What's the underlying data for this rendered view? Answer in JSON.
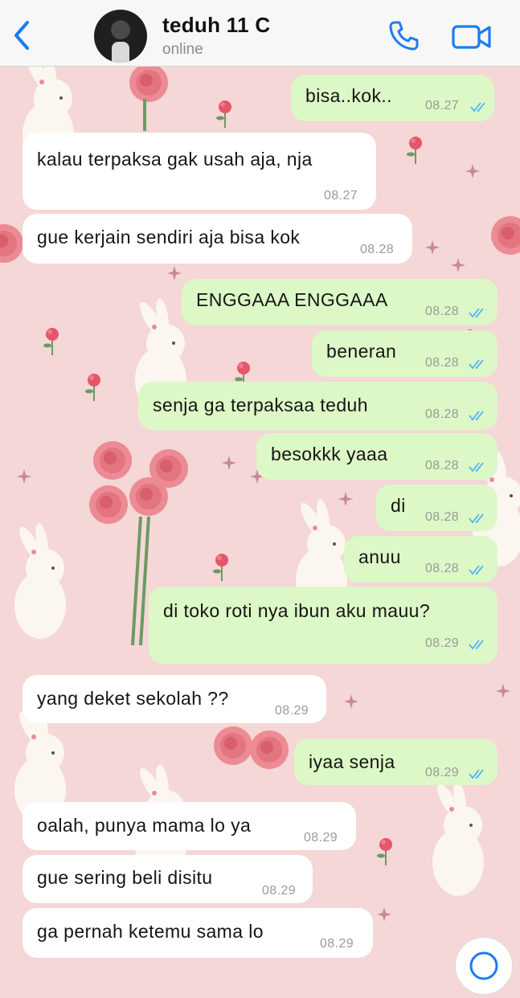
{
  "header": {
    "contact_name": "teduh 11 C",
    "status": "online",
    "accent": "#1b7cf2"
  },
  "messages": [
    {
      "dir": "out",
      "text": "bisa..kok..",
      "time": "08.27",
      "read": true
    },
    {
      "dir": "in",
      "text": "kalau terpaksa gak usah aja, nja",
      "time": "08.27"
    },
    {
      "dir": "in",
      "text": "gue kerjain sendiri aja bisa kok",
      "time": "08.28"
    },
    {
      "dir": "out",
      "text": "ENGGAAA ENGGAAA",
      "time": "08.28",
      "read": true
    },
    {
      "dir": "out",
      "text": "beneran",
      "time": "08.28",
      "read": true
    },
    {
      "dir": "out",
      "text": "senja ga terpaksaa teduh",
      "time": "08.28",
      "read": true
    },
    {
      "dir": "out",
      "text": "besokkk yaaa",
      "time": "08.28",
      "read": true
    },
    {
      "dir": "out",
      "text": "di",
      "time": "08.28",
      "read": true
    },
    {
      "dir": "out",
      "text": "anuu",
      "time": "08.28",
      "read": true
    },
    {
      "dir": "out",
      "text": "di toko roti nya ibun aku mauu?",
      "time": "08.29",
      "read": true
    },
    {
      "dir": "in",
      "text": "yang deket sekolah ??",
      "time": "08.29"
    },
    {
      "dir": "out",
      "text": "iyaa senja",
      "time": "08.29",
      "read": true
    },
    {
      "dir": "in",
      "text": "oalah, punya mama lo ya",
      "time": "08.29"
    },
    {
      "dir": "in",
      "text": "gue sering beli disitu",
      "time": "08.29"
    },
    {
      "dir": "in",
      "text": "ga pernah ketemu sama lo",
      "time": "08.29"
    }
  ],
  "colors": {
    "outgoing_bubble": "#dcf8c6",
    "incoming_bubble": "#ffffff",
    "read_ticks": "#4fb3f6",
    "wallpaper": "#f4d7d6"
  },
  "icons": [
    "back-chevron-icon",
    "phone-icon",
    "video-camera-icon",
    "double-check-icon",
    "scroll-down-icon"
  ]
}
